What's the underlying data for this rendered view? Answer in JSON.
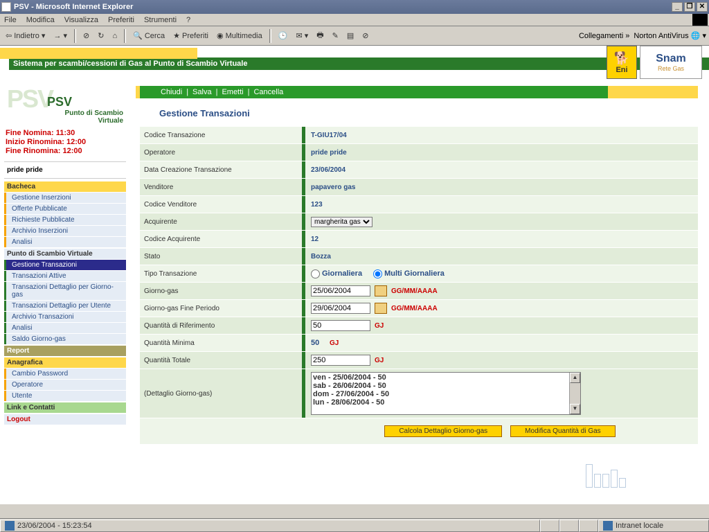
{
  "window": {
    "title": "PSV - Microsoft Internet Explorer"
  },
  "menu": {
    "file": "File",
    "edit": "Modifica",
    "view": "Visualizza",
    "fav": "Preferiti",
    "tools": "Strumenti",
    "help": "?"
  },
  "tb": {
    "back": "Indietro",
    "search": "Cerca",
    "fav": "Preferiti",
    "media": "Multimedia",
    "links": "Collegamenti",
    "nav": "Norton AntiVirus"
  },
  "banner": {
    "text": "Sistema per scambi/cessioni di Gas al Punto di Scambio Virtuale"
  },
  "logo": {
    "eni": "Eni",
    "snam1": "Snam",
    "snam2": "Rete Gas",
    "psv": "PSV",
    "psvsub1": "Punto di Scambio",
    "psvsub2": "Virtuale"
  },
  "times": {
    "l1": "Fine Nomina: 11:30",
    "l2": "Inizio Rinomina: 12:00",
    "l3": "Fine Rinomina: 12:00"
  },
  "user": "pride pride",
  "nav": {
    "bacheca": "Bacheca",
    "b": [
      "Gestione Inserzioni",
      "Offerte Pubblicate",
      "Richieste Pubblicate",
      "Archivio Inserzioni",
      "Analisi"
    ],
    "psv": "Punto di Scambio Virtuale",
    "p": [
      "Gestione Transazioni",
      "Transazioni Attive",
      "Transazioni Dettaglio per Giorno-gas",
      "Transazioni Dettaglio per Utente",
      "Archivio Transazioni",
      "Analisi",
      "Saldo Giorno-gas"
    ],
    "report": "Report",
    "anag": "Anagrafica",
    "a": [
      "Cambio Password",
      "Operatore",
      "Utente"
    ],
    "link": "Link e Contatti",
    "logout": "Logout"
  },
  "actions": {
    "chiudi": "Chiudi",
    "salva": "Salva",
    "emetti": "Emetti",
    "cancella": "Cancella",
    "sep": "|"
  },
  "page": {
    "title": "Gestione Transazioni"
  },
  "f": {
    "cod_lab": "Codice Transazione",
    "cod": "T-GIU17/04",
    "op_lab": "Operatore",
    "op": "pride pride",
    "data_lab": "Data Creazione Transazione",
    "data": "23/06/2004",
    "vend_lab": "Venditore",
    "vend": "papavero gas",
    "codvend_lab": "Codice Venditore",
    "codvend": "123",
    "acq_lab": "Acquirente",
    "acq": "margherita gas",
    "codacq_lab": "Codice Acquirente",
    "codacq": "12",
    "stato_lab": "Stato",
    "stato": "Bozza",
    "tipo_lab": "Tipo Transazione",
    "tipo_g": "Giornaliera",
    "tipo_m": "Multi Giornaliera",
    "gg_lab": "Giorno-gas",
    "gg": "25/06/2004",
    "ggf_lab": "Giorno-gas Fine Periodo",
    "ggf": "29/06/2004",
    "hint": "GG/MM/AAAA",
    "qr_lab": "Quantità di Riferimento",
    "qr": "50",
    "qm_lab": "Quantità Minima",
    "qm": "50",
    "qt_lab": "Quantità Totale",
    "qt": "250",
    "gj": "GJ",
    "det_lab": "(Dettaglio Giorno-gas)",
    "det": [
      "ven - 25/06/2004 - 50",
      "sab - 26/06/2004 - 50",
      "dom - 27/06/2004 - 50",
      "lun - 28/06/2004 - 50"
    ],
    "btn1": "Calcola Dettaglio Giorno-gas",
    "btn2": "Modifica Quantità di Gas"
  },
  "status": {
    "time": "23/06/2004 - 15:23:54",
    "zone": "Intranet locale"
  }
}
